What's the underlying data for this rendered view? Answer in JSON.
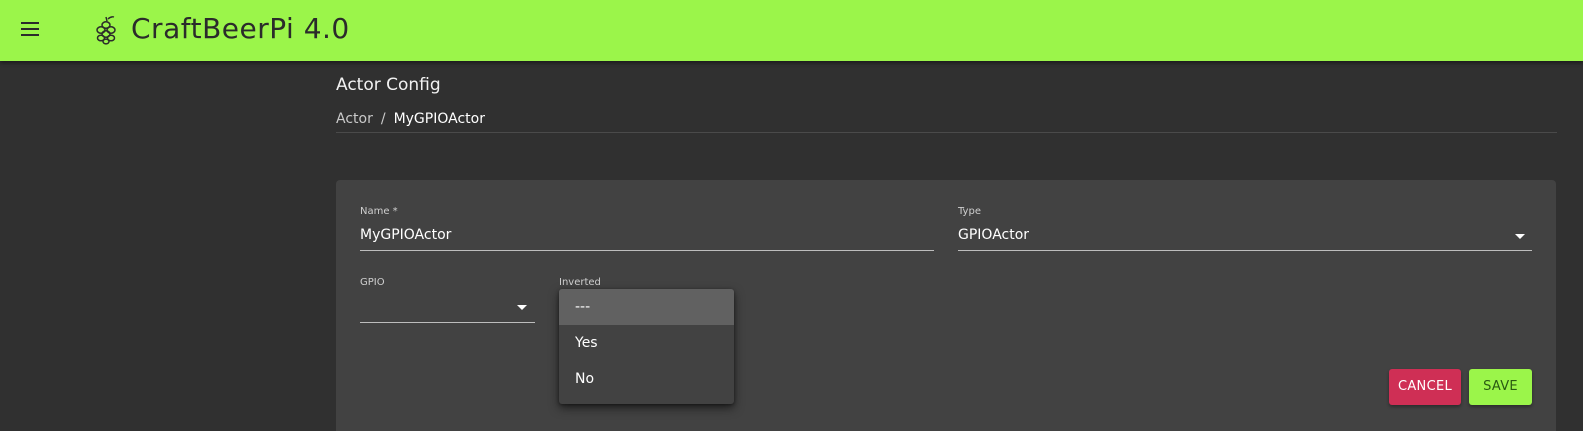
{
  "app": {
    "title": "CraftBeerPi 4.0"
  },
  "page": {
    "title": "Actor Config"
  },
  "breadcrumb": {
    "parent": "Actor",
    "separator": "/",
    "current": "MyGPIOActor"
  },
  "form": {
    "name": {
      "label": "Name *",
      "value": "MyGPIOActor"
    },
    "type": {
      "label": "Type",
      "value": "GPIOActor"
    },
    "gpio": {
      "label": "GPIO",
      "value": ""
    },
    "inverted": {
      "label": "Inverted"
    }
  },
  "dropdown": {
    "options": [
      {
        "label": "---",
        "selected": true
      },
      {
        "label": "Yes",
        "selected": false
      },
      {
        "label": "No",
        "selected": false
      }
    ]
  },
  "buttons": {
    "cancel": "CANCEL",
    "save": "SAVE"
  },
  "icons": {
    "menu": "hamburger-menu-icon",
    "logo": "hops-icon",
    "select": "chevron-down-icon"
  },
  "colors": {
    "appbar": "#9bf54a",
    "cancel": "#cf2f55",
    "save": "#9bf54a",
    "background": "#303030",
    "card": "#424242"
  }
}
